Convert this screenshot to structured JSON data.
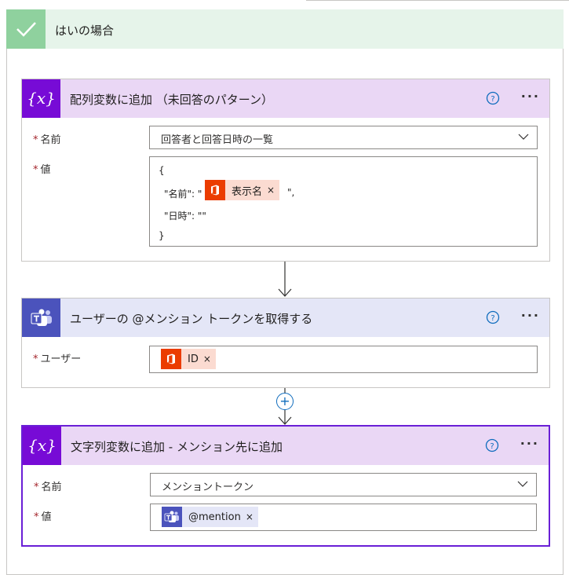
{
  "branch": {
    "title": "はいの場合"
  },
  "actions": [
    {
      "title": "配列変数に追加 （未回答のパターン）",
      "icon": "variable-icon",
      "fields": {
        "name_label": "名前",
        "name_value": "回答者と回答日時の一覧",
        "value_label": "値",
        "value_lines": [
          "{",
          "\"名前\": \"",
          "\",",
          "\"日時\": \"\"",
          "}"
        ],
        "token": {
          "icon": "office-icon",
          "label": "表示名",
          "remove": "×"
        }
      }
    },
    {
      "title": "ユーザーの @メンション トークンを取得する",
      "icon": "teams-icon",
      "fields": {
        "user_label": "ユーザー",
        "token": {
          "icon": "office-icon",
          "label": "ID",
          "remove": "×"
        }
      }
    },
    {
      "title": "文字列変数に追加 - メンション先に追加",
      "icon": "variable-icon",
      "fields": {
        "name_label": "名前",
        "name_value": "メンショントークン",
        "value_label": "値",
        "token": {
          "icon": "teams-icon",
          "label": "@mention",
          "remove": "×"
        }
      }
    }
  ],
  "ui": {
    "required_mark": "*",
    "more": "···",
    "plus": "+"
  },
  "colors": {
    "variable": "#770bd6",
    "teams": "#4b53bc",
    "office": "#eb3c00",
    "selected_border": "#6a1fd6",
    "branch_check": "#8fd19e"
  }
}
